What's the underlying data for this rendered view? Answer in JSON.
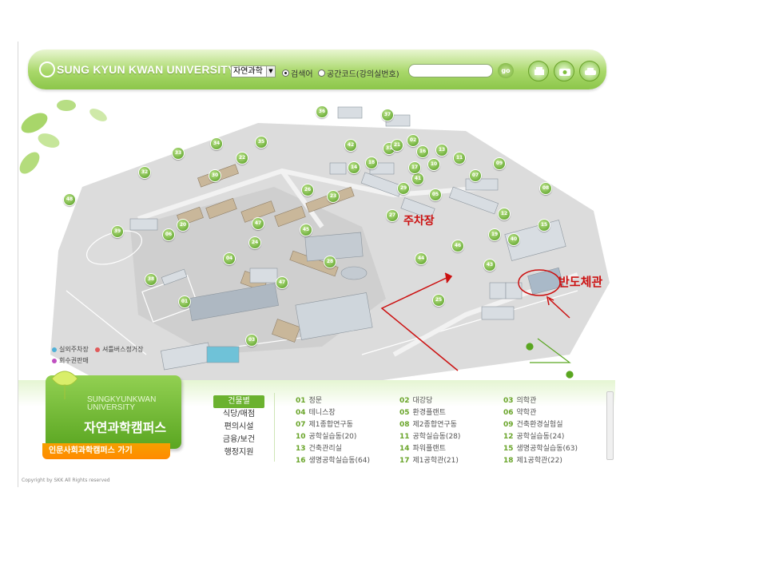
{
  "header": {
    "logo_text": "SUNG KYUN KWAN UNIVERSITY",
    "campus_select": "자연과학",
    "radio_keyword": "검색어",
    "radio_spacecode": "공간코드(강의실번호)",
    "go_label": "go",
    "icons": [
      "print-icon",
      "camera-icon",
      "car-icon"
    ]
  },
  "map": {
    "pins": [
      "36",
      "37",
      "33",
      "34",
      "35",
      "32",
      "31",
      "13",
      "11",
      "10",
      "09",
      "08",
      "07",
      "12",
      "42",
      "02",
      "21",
      "16",
      "15",
      "14",
      "30",
      "22",
      "26",
      "27",
      "23",
      "29",
      "41",
      "17",
      "18",
      "19",
      "20",
      "06",
      "39",
      "40",
      "44",
      "48",
      "45",
      "47",
      "25",
      "28",
      "01",
      "03",
      "38",
      "43",
      "46",
      "05",
      "04",
      "47",
      "24"
    ],
    "annotation_parking": "주차장",
    "annotation_semicon": "반도체관",
    "highlight_color": "#cc1111"
  },
  "legend": {
    "outdoor_parking": "실외주차장",
    "shuttle_stop": "셔틀버스정거장",
    "ticket_sales": "회수권판매"
  },
  "campus_card": {
    "english": "SUNGKYUNKWAN UNIVERSITY",
    "korean": "자연과학캠퍼스",
    "other_campus_link": "인문사회과학캠퍼스 가기"
  },
  "tabs": [
    "건물별",
    "식당/매점",
    "편의시설",
    "금융/보건",
    "행정지원"
  ],
  "buildings": [
    {
      "num": "01",
      "name": "정문"
    },
    {
      "num": "02",
      "name": "대강당"
    },
    {
      "num": "03",
      "name": "의학관"
    },
    {
      "num": "04",
      "name": "테니스장"
    },
    {
      "num": "05",
      "name": "환경플랜트"
    },
    {
      "num": "06",
      "name": "약학관"
    },
    {
      "num": "07",
      "name": "제1종합연구동"
    },
    {
      "num": "08",
      "name": "제2종합연구동"
    },
    {
      "num": "09",
      "name": "건축환경실험실"
    },
    {
      "num": "10",
      "name": "공학실습동(20)"
    },
    {
      "num": "11",
      "name": "공학실습동(28)"
    },
    {
      "num": "12",
      "name": "공학실습동(24)"
    },
    {
      "num": "13",
      "name": "건축관리실"
    },
    {
      "num": "14",
      "name": "파워플랜트"
    },
    {
      "num": "15",
      "name": "생명공학실습동(63)"
    },
    {
      "num": "16",
      "name": "생명공학실습동(64)"
    },
    {
      "num": "17",
      "name": "제1공학관(21)"
    },
    {
      "num": "18",
      "name": "제1공학관(22)"
    }
  ],
  "copyright": "Copyright by SKK All Rights reserved"
}
